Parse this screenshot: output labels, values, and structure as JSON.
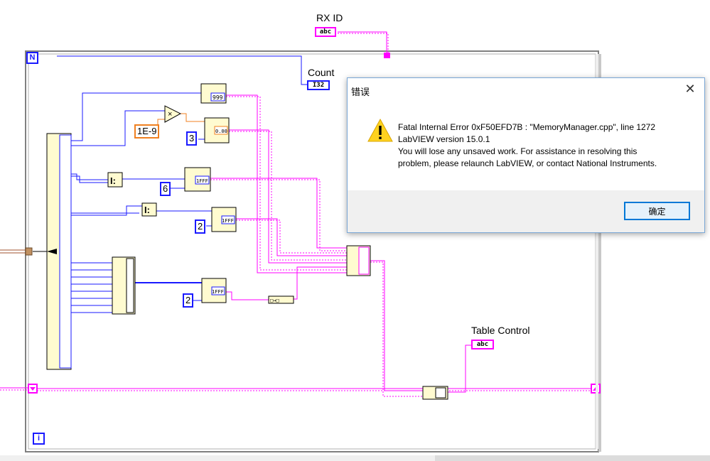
{
  "diagram": {
    "labels": {
      "rx_id": "RX  ID",
      "count": "Count",
      "table_control": "Table Control"
    },
    "terminals": {
      "rx_id": "abc",
      "count": "I32",
      "table_control": "abc"
    },
    "loop": {
      "n_label": "N",
      "i_label": "i"
    },
    "constants": {
      "epsilon": "1E-9",
      "three": "3",
      "six": "6",
      "two_a": "2",
      "two_b": "2"
    },
    "nodes": {
      "format_999": "999",
      "format_float": "0.00",
      "format_hex_a": "1FFF",
      "format_hex_b": "1FFF",
      "format_hex_c": "1FFF"
    },
    "colors": {
      "string_wire": "#ff00ff",
      "numeric_wire": "#1a1aff",
      "float_wire": "#f08020",
      "cluster_wire": "#a0522d"
    }
  },
  "dialog": {
    "title": "错误",
    "close": "✕",
    "icon": "warning-icon",
    "message_lines": [
      "Fatal Internal Error 0xF50EFD7B :  \"MemoryManager.cpp\", line 1272",
      "LabVIEW version 15.0.1",
      "You will lose any unsaved work.  For assistance in resolving this",
      "problem, please relaunch LabVIEW, or contact National Instruments."
    ],
    "ok_label": "确定"
  }
}
